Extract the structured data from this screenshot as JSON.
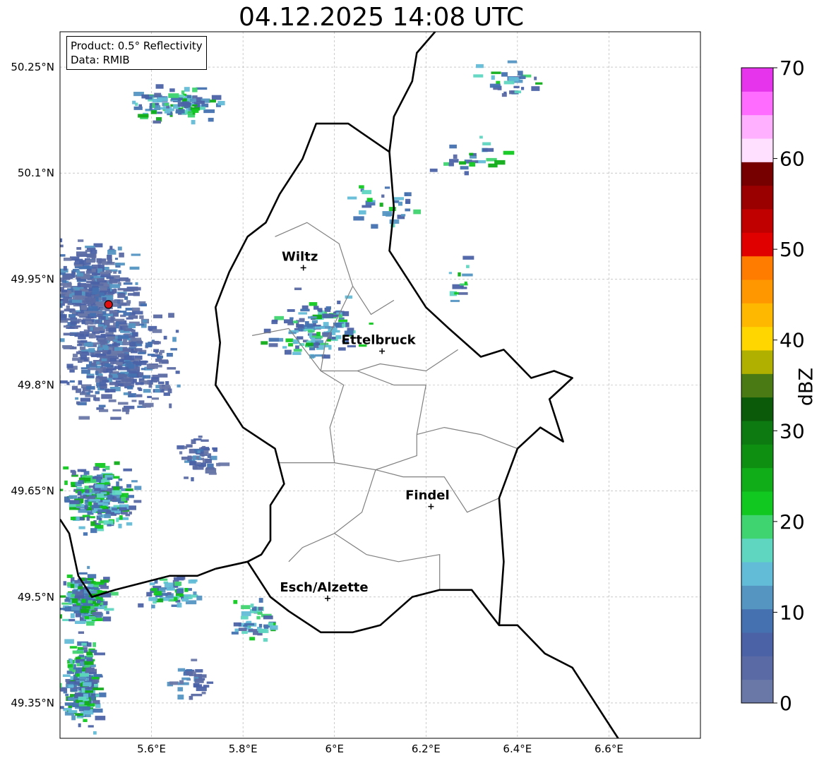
{
  "title": "04.12.2025 14:08 UTC",
  "infobox": {
    "product": "Product: 0.5° Reflectivity",
    "data_source": "Data: RMIB"
  },
  "map": {
    "extent": {
      "lon_min": 5.4,
      "lon_max": 6.8,
      "lat_min": 49.3,
      "lat_max": 50.3
    },
    "lat_ticks": [
      {
        "value": 50.25,
        "label": "50.25°N"
      },
      {
        "value": 50.1,
        "label": "50.1°N"
      },
      {
        "value": 49.95,
        "label": "49.95°N"
      },
      {
        "value": 49.8,
        "label": "49.8°N"
      },
      {
        "value": 49.65,
        "label": "49.65°N"
      },
      {
        "value": 49.5,
        "label": "49.5°N"
      },
      {
        "value": 49.35,
        "label": "49.35°N"
      }
    ],
    "lon_ticks": [
      {
        "value": 5.6,
        "label": "5.6°E"
      },
      {
        "value": 5.8,
        "label": "5.8°E"
      },
      {
        "value": 6.0,
        "label": "6°E"
      },
      {
        "value": 6.2,
        "label": "6.2°E"
      },
      {
        "value": 6.4,
        "label": "6.4°E"
      },
      {
        "value": 6.6,
        "label": "6.6°E"
      }
    ],
    "radar_site": {
      "lon": 5.506,
      "lat": 49.914,
      "color": "#e01010"
    },
    "cities": [
      {
        "name": "Wiltz",
        "lon": 5.932,
        "lat": 49.966
      },
      {
        "name": "Ettelbruck",
        "lon": 6.104,
        "lat": 49.848
      },
      {
        "name": "Findel",
        "lon": 6.211,
        "lat": 49.628
      },
      {
        "name": "Esch/Alzette",
        "lon": 5.985,
        "lat": 49.498
      }
    ],
    "country_border": [
      [
        5.74,
        49.54
      ],
      [
        5.81,
        49.55
      ],
      [
        5.86,
        49.5
      ],
      [
        5.9,
        49.48
      ],
      [
        5.97,
        49.45
      ],
      [
        6.04,
        49.45
      ],
      [
        6.1,
        49.46
      ],
      [
        6.17,
        49.5
      ],
      [
        6.23,
        49.51
      ],
      [
        6.3,
        49.51
      ],
      [
        6.36,
        49.46
      ],
      [
        6.37,
        49.55
      ],
      [
        6.36,
        49.64
      ],
      [
        6.4,
        49.71
      ],
      [
        6.45,
        49.74
      ],
      [
        6.5,
        49.72
      ],
      [
        6.47,
        49.78
      ],
      [
        6.52,
        49.81
      ],
      [
        6.48,
        49.82
      ],
      [
        6.43,
        49.81
      ],
      [
        6.37,
        49.85
      ],
      [
        6.32,
        49.84
      ],
      [
        6.25,
        49.88
      ],
      [
        6.2,
        49.91
      ],
      [
        6.16,
        49.95
      ],
      [
        6.12,
        49.99
      ],
      [
        6.13,
        50.05
      ],
      [
        6.12,
        50.13
      ],
      [
        6.03,
        50.17
      ],
      [
        5.96,
        50.17
      ],
      [
        5.93,
        50.12
      ],
      [
        5.88,
        50.07
      ],
      [
        5.85,
        50.03
      ],
      [
        5.81,
        50.01
      ],
      [
        5.77,
        49.96
      ],
      [
        5.74,
        49.91
      ],
      [
        5.75,
        49.86
      ],
      [
        5.74,
        49.8
      ],
      [
        5.8,
        49.74
      ],
      [
        5.87,
        49.71
      ],
      [
        5.89,
        49.66
      ],
      [
        5.86,
        49.63
      ],
      [
        5.86,
        49.58
      ],
      [
        5.84,
        49.56
      ],
      [
        5.81,
        49.55
      ]
    ],
    "belgium_france_border": [
      [
        5.4,
        49.61
      ],
      [
        5.42,
        49.59
      ],
      [
        5.44,
        49.53
      ],
      [
        5.47,
        49.5
      ],
      [
        5.52,
        49.51
      ],
      [
        5.58,
        49.52
      ],
      [
        5.64,
        49.53
      ],
      [
        5.7,
        49.53
      ],
      [
        5.74,
        49.54
      ]
    ],
    "germany_border_north": [
      [
        6.12,
        50.13
      ],
      [
        6.13,
        50.18
      ],
      [
        6.17,
        50.23
      ],
      [
        6.18,
        50.27
      ],
      [
        6.22,
        50.3
      ]
    ],
    "germany_border_south": [
      [
        6.36,
        49.46
      ],
      [
        6.4,
        49.46
      ],
      [
        6.46,
        49.42
      ],
      [
        6.52,
        49.4
      ],
      [
        6.56,
        49.36
      ],
      [
        6.59,
        49.33
      ],
      [
        6.62,
        49.3
      ]
    ],
    "cantons": [
      [
        [
          5.87,
          50.01
        ],
        [
          5.94,
          50.03
        ],
        [
          6.01,
          50.0
        ],
        [
          6.04,
          49.94
        ],
        [
          6.08,
          49.9
        ],
        [
          6.13,
          49.92
        ]
      ],
      [
        [
          6.04,
          49.94
        ],
        [
          5.98,
          49.86
        ],
        [
          5.97,
          49.82
        ]
      ],
      [
        [
          5.82,
          49.87
        ],
        [
          5.9,
          49.88
        ],
        [
          5.97,
          49.82
        ],
        [
          6.05,
          49.82
        ],
        [
          6.1,
          49.83
        ],
        [
          6.2,
          49.82
        ],
        [
          6.27,
          49.85
        ]
      ],
      [
        [
          5.97,
          49.82
        ],
        [
          6.02,
          49.8
        ],
        [
          5.99,
          49.74
        ],
        [
          6.0,
          49.69
        ]
      ],
      [
        [
          6.05,
          49.82
        ],
        [
          6.13,
          49.8
        ],
        [
          6.2,
          49.8
        ],
        [
          6.18,
          49.73
        ]
      ],
      [
        [
          6.18,
          49.73
        ],
        [
          6.24,
          49.74
        ],
        [
          6.32,
          49.73
        ],
        [
          6.4,
          49.71
        ]
      ],
      [
        [
          5.88,
          49.69
        ],
        [
          6.0,
          49.69
        ],
        [
          6.09,
          49.68
        ],
        [
          6.18,
          49.7
        ],
        [
          6.18,
          49.73
        ]
      ],
      [
        [
          6.09,
          49.68
        ],
        [
          6.06,
          49.62
        ],
        [
          6.0,
          49.59
        ],
        [
          5.93,
          49.57
        ],
        [
          5.9,
          49.55
        ]
      ],
      [
        [
          6.09,
          49.68
        ],
        [
          6.15,
          49.67
        ],
        [
          6.24,
          49.67
        ],
        [
          6.29,
          49.62
        ],
        [
          6.36,
          49.64
        ]
      ],
      [
        [
          6.0,
          49.59
        ],
        [
          6.07,
          49.56
        ],
        [
          6.14,
          49.55
        ],
        [
          6.23,
          49.56
        ],
        [
          6.23,
          49.51
        ]
      ]
    ]
  },
  "colorbar": {
    "label": "dBZ",
    "tick_labels": [
      {
        "value": 0,
        "label": "0"
      },
      {
        "value": 10,
        "label": "10"
      },
      {
        "value": 20,
        "label": "20"
      },
      {
        "value": 30,
        "label": "30"
      },
      {
        "value": 40,
        "label": "40"
      },
      {
        "value": 50,
        "label": "50"
      },
      {
        "value": 60,
        "label": "60"
      },
      {
        "value": 70,
        "label": "70"
      }
    ],
    "colors": [
      "#6a78a8",
      "#5a6aa4",
      "#4b62a6",
      "#4571b0",
      "#5495c2",
      "#63bcd7",
      "#5ed6c0",
      "#40d470",
      "#11c820",
      "#10ad18",
      "#0f8f12",
      "#0c7a10",
      "#0a5a0a",
      "#4a7a14",
      "#b0b000",
      "#ffd600",
      "#ffb800",
      "#ff9800",
      "#ff7c00",
      "#e00000",
      "#c00000",
      "#9a0000",
      "#760000",
      "#ffe0ff",
      "#ffb0ff",
      "#ff6cff",
      "#e534ec"
    ]
  },
  "echo_clusters": [
    {
      "lon": 5.46,
      "lat": 49.93,
      "spread_lon": 0.14,
      "spread_lat": 0.09,
      "n": 420,
      "level": "low"
    },
    {
      "lon": 5.52,
      "lat": 49.84,
      "spread_lon": 0.16,
      "spread_lat": 0.1,
      "n": 420,
      "level": "low"
    },
    {
      "lon": 5.48,
      "lat": 49.64,
      "spread_lon": 0.1,
      "spread_lat": 0.06,
      "n": 260,
      "level": "mixed"
    },
    {
      "lon": 5.45,
      "lat": 49.5,
      "spread_lon": 0.07,
      "spread_lat": 0.05,
      "n": 200,
      "level": "mixed"
    },
    {
      "lon": 5.44,
      "lat": 49.38,
      "spread_lon": 0.05,
      "spread_lat": 0.08,
      "n": 230,
      "level": "mixed"
    },
    {
      "lon": 5.65,
      "lat": 50.2,
      "spread_lon": 0.14,
      "spread_lat": 0.03,
      "n": 110,
      "level": "mixed"
    },
    {
      "lon": 5.95,
      "lat": 49.88,
      "spread_lon": 0.13,
      "spread_lat": 0.06,
      "n": 140,
      "level": "mixed"
    },
    {
      "lon": 5.7,
      "lat": 49.7,
      "spread_lon": 0.06,
      "spread_lat": 0.04,
      "n": 60,
      "level": "low"
    },
    {
      "lon": 5.64,
      "lat": 49.51,
      "spread_lon": 0.08,
      "spread_lat": 0.03,
      "n": 60,
      "level": "mixed"
    },
    {
      "lon": 5.82,
      "lat": 49.47,
      "spread_lon": 0.08,
      "spread_lat": 0.04,
      "n": 45,
      "level": "mixed"
    },
    {
      "lon": 6.38,
      "lat": 50.23,
      "spread_lon": 0.1,
      "spread_lat": 0.04,
      "n": 30,
      "level": "mixed"
    },
    {
      "lon": 6.28,
      "lat": 50.12,
      "spread_lon": 0.1,
      "spread_lat": 0.05,
      "n": 24,
      "level": "mixed"
    },
    {
      "lon": 6.1,
      "lat": 50.05,
      "spread_lon": 0.12,
      "spread_lat": 0.05,
      "n": 30,
      "level": "mixed"
    },
    {
      "lon": 6.27,
      "lat": 49.95,
      "spread_lon": 0.05,
      "spread_lat": 0.04,
      "n": 14,
      "level": "mixed"
    },
    {
      "lon": 5.68,
      "lat": 49.38,
      "spread_lon": 0.07,
      "spread_lat": 0.04,
      "n": 30,
      "level": "low"
    }
  ]
}
